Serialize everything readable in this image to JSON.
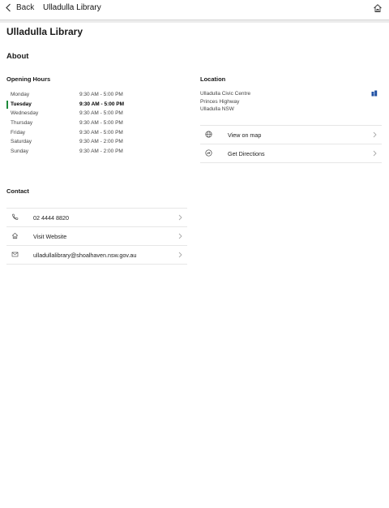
{
  "nav": {
    "back_label": "Back",
    "title": "Ulladulla Library"
  },
  "page": {
    "title": "Ulladulla Library"
  },
  "about": {
    "heading": "About"
  },
  "hours": {
    "heading": "Opening Hours",
    "rows": [
      {
        "day": "Monday",
        "time": "9:30 AM - 5:00 PM",
        "today": false
      },
      {
        "day": "Tuesday",
        "time": "9:30 AM - 5:00 PM",
        "today": true
      },
      {
        "day": "Wednesday",
        "time": "9:30 AM - 5:00 PM",
        "today": false
      },
      {
        "day": "Thursday",
        "time": "9:30 AM - 5:00 PM",
        "today": false
      },
      {
        "day": "Friday",
        "time": "9:30 AM - 5:00 PM",
        "today": false
      },
      {
        "day": "Saturday",
        "time": "9:30 AM - 2:00 PM",
        "today": false
      },
      {
        "day": "Sunday",
        "time": "9:30 AM - 2:00 PM",
        "today": false
      }
    ]
  },
  "location": {
    "heading": "Location",
    "address": [
      "Ulladulla Civic Centre",
      "Princes Highway",
      "Ulladulla NSW"
    ],
    "actions": [
      {
        "label": "View on map",
        "icon": "globe-icon"
      },
      {
        "label": "Get Directions",
        "icon": "directions-icon"
      }
    ]
  },
  "contact": {
    "heading": "Contact",
    "items": [
      {
        "label": "02 4444 8820",
        "icon": "phone-icon"
      },
      {
        "label": "Visit Website",
        "icon": "home-icon"
      },
      {
        "label": "ulladullalibrary@shoalhaven.nsw.gov.au",
        "icon": "mail-icon"
      }
    ]
  },
  "colors": {
    "today_marker": "#1d8a3a",
    "map_icon": "#1f4fa0",
    "divider": "#e6e6e6"
  }
}
